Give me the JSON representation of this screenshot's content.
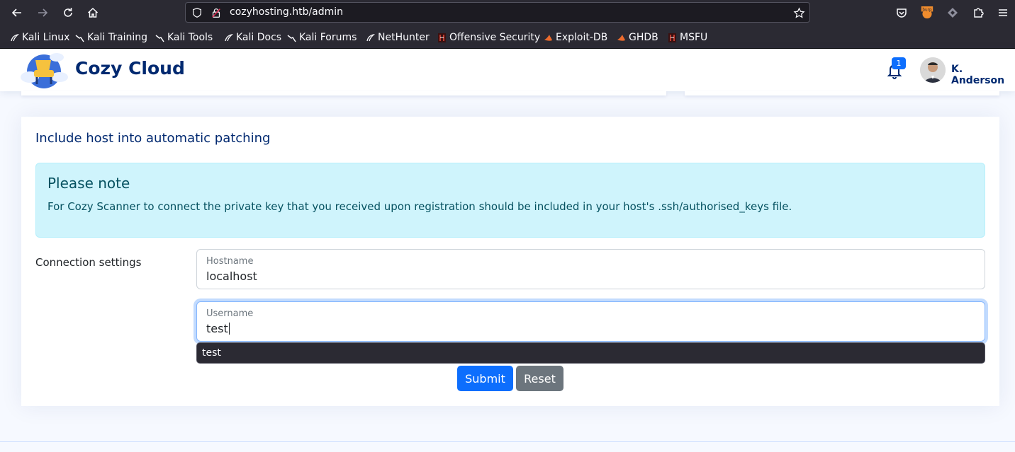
{
  "browser": {
    "url": "cozyhosting.htb/admin",
    "bookmarks": [
      {
        "label": "Kali Linux",
        "icon": "kali-dragon-icon"
      },
      {
        "label": "Kali Training",
        "icon": "kali-dragon-icon"
      },
      {
        "label": "Kali Tools",
        "icon": "kali-dragon-icon"
      },
      {
        "label": "Kali Docs",
        "icon": "kali-dragon-icon"
      },
      {
        "label": "Kali Forums",
        "icon": "kali-dragon-icon"
      },
      {
        "label": "NetHunter",
        "icon": "kali-dragon-icon"
      },
      {
        "label": "Offensive Security",
        "icon": "offsec-icon"
      },
      {
        "label": "Exploit-DB",
        "icon": "exploitdb-icon"
      },
      {
        "label": "GHDB",
        "icon": "exploitdb-icon"
      },
      {
        "label": "MSFU",
        "icon": "offsec-icon"
      }
    ],
    "extension_label": "burp"
  },
  "header": {
    "brand": "Cozy Cloud",
    "notification_count": "1",
    "user_name": "K. Anderson"
  },
  "card": {
    "title": "Include host into automatic patching",
    "alert": {
      "heading": "Please note",
      "text": "For Cozy Scanner to connect the private key that you received upon registration should be included in your host's .ssh/authorised_keys file."
    },
    "connection_label": "Connection settings",
    "hostname": {
      "label": "Hostname",
      "value": "localhost"
    },
    "username": {
      "label": "Username",
      "value": "test"
    },
    "autocomplete": [
      "test"
    ],
    "submit_label": "Submit",
    "reset_label": "Reset"
  },
  "colors": {
    "brand": "#012970",
    "primary": "#0d6efd",
    "secondary": "#6c757d",
    "alert_bg": "#cff4fc",
    "alert_text": "#055160",
    "browser_bg": "#2b2a33"
  }
}
